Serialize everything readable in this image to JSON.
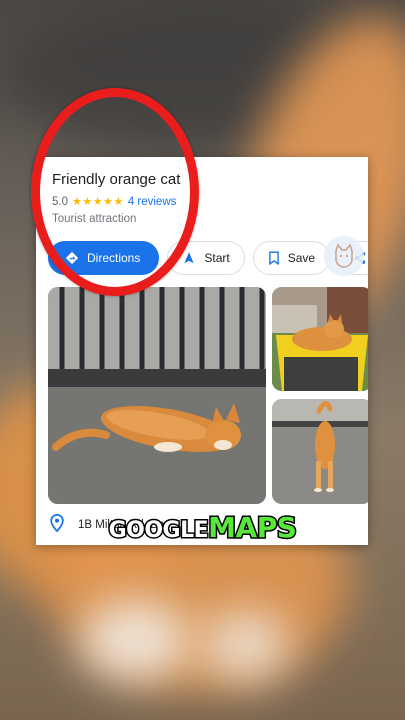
{
  "place": {
    "name": "Friendly orange cat",
    "rating": "5.0",
    "stars": "★★★★★",
    "reviews": "4 reviews",
    "category": "Tourist attraction",
    "address": "1B Milton Rd, Ea..."
  },
  "actions": {
    "directions": "Directions",
    "start": "Start",
    "save": "Save"
  },
  "caption": {
    "word1": "GOOGLE",
    "word2": "MAPS"
  },
  "colors": {
    "accent": "#1a73e8",
    "star": "#fbbc04",
    "annotation_ring": "#ea1d1d",
    "caption_highlight": "#58e83b"
  }
}
